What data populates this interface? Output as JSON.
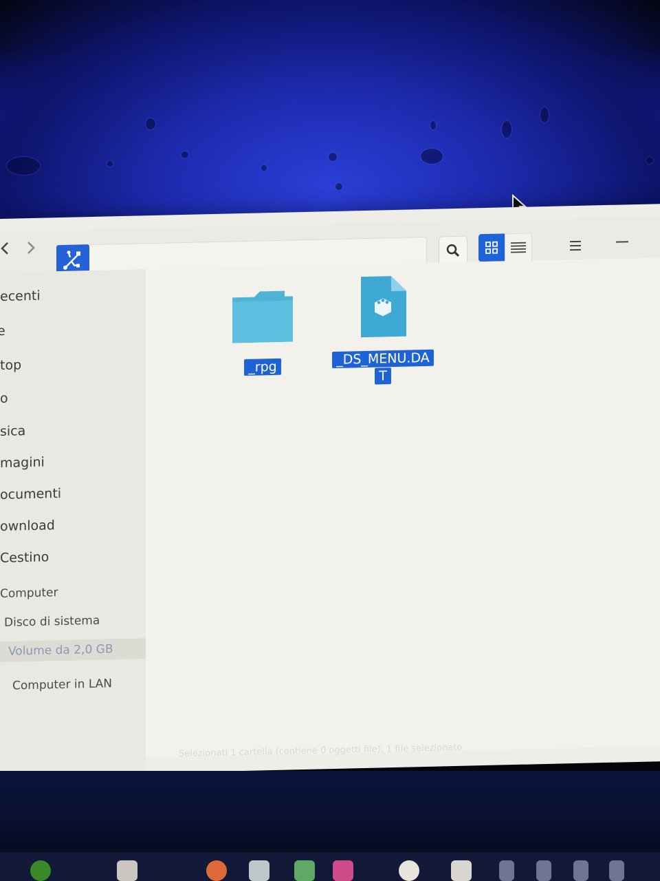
{
  "toolbar": {
    "back_icon": "chevron-left-icon",
    "forward_icon": "chevron-right-icon",
    "location_icon": "usb-icon",
    "search_icon": "search-icon",
    "grid_view_icon": "grid-view-icon",
    "list_view_icon": "list-view-icon",
    "menu_icon": "hamburger-menu-icon",
    "minimize_icon": "minimize-icon",
    "accent_color": "#1f64d6"
  },
  "sidebar": {
    "items": [
      {
        "label": "ecenti"
      },
      {
        "label": "e"
      },
      {
        "label": "top"
      },
      {
        "label": "o"
      },
      {
        "label": "sica"
      },
      {
        "label": "magini"
      },
      {
        "label": "ocumenti"
      },
      {
        "label": "ownload"
      },
      {
        "label": "Cestino"
      }
    ],
    "computer_header": "Computer",
    "devices": [
      {
        "label": "Disco di sistema"
      },
      {
        "label": "Volume da 2,0 GB",
        "active": true
      }
    ],
    "network": {
      "label": "Computer in LAN"
    }
  },
  "files": [
    {
      "name": "_rpg",
      "type": "folder",
      "color": "#4db3d9"
    },
    {
      "name_line1": "_DS_MENU.DA",
      "name_line2": "T",
      "type": "data-file",
      "color": "#3fa9d6"
    }
  ],
  "statusbar": {
    "text": "Selezionati 1 cartella (contiene 0 oggetti file), 1 file selezionato"
  }
}
